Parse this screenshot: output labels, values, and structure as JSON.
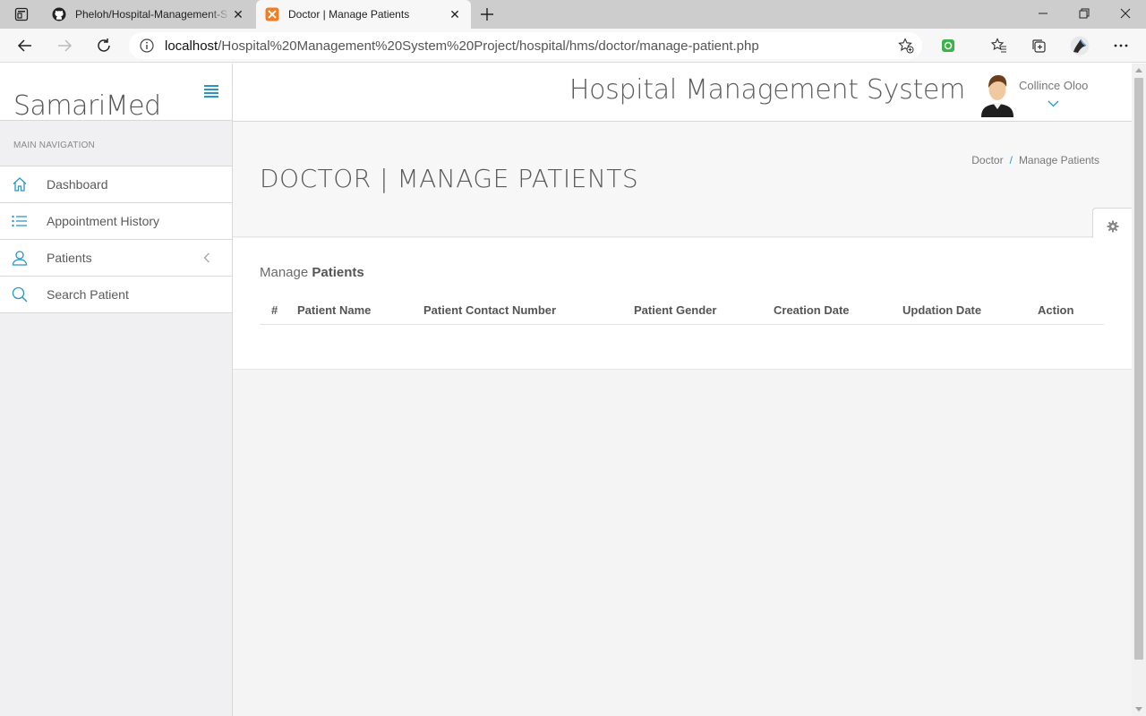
{
  "browser": {
    "tabs": [
      {
        "title": "Pheloh/Hospital-Management-S",
        "favicon": "github-icon"
      },
      {
        "title": "Doctor | Manage Patients",
        "favicon": "xampp-icon"
      }
    ],
    "address": {
      "host": "localhost",
      "path": "/Hospital%20Management%20System%20Project/hospital/hms/doctor/manage-patient.php"
    }
  },
  "sidebar": {
    "brand": "SamariMed",
    "nav_heading": "MAIN NAVIGATION",
    "items": [
      {
        "label": "Dashboard",
        "icon": "home-icon"
      },
      {
        "label": "Appointment History",
        "icon": "list-icon"
      },
      {
        "label": "Patients",
        "icon": "user-icon"
      },
      {
        "label": "Search Patient",
        "icon": "search-icon"
      }
    ]
  },
  "header": {
    "app_title": "Hospital Management System",
    "user_name": "Collince Oloo"
  },
  "page": {
    "title": "DOCTOR | MANAGE PATIENTS",
    "breadcrumb": [
      "Doctor",
      "Manage Patients"
    ]
  },
  "panel": {
    "title_prefix": "Manage ",
    "title_bold": "Patients",
    "columns": [
      "#",
      "Patient Name",
      "Patient Contact Number",
      "Patient Gender",
      "Creation Date",
      "Updation Date",
      "Action"
    ],
    "rows": []
  },
  "colors": {
    "accent": "#2896c8",
    "sidebar_bg": "#f0f0f2",
    "page_bg": "#f4f4f4"
  }
}
